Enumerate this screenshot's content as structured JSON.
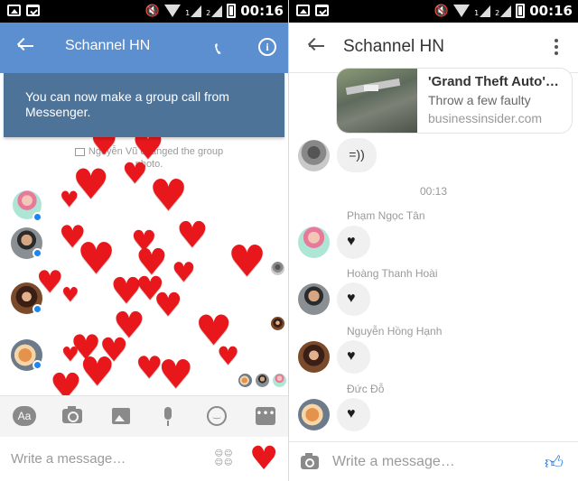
{
  "left_screen": {
    "status_bar": {
      "time": "00:16",
      "sim_labels": [
        "1",
        "2"
      ]
    },
    "header": {
      "title": "Schannel HN",
      "accent_color": "#5b8fcf"
    },
    "banner": {
      "text": "You can now make a group call from Messenger."
    },
    "system_note": "Nguyễn Vũ changed the group photo.",
    "icons": [
      "back-arrow-icon",
      "phone-icon",
      "info-icon",
      "heart-icon",
      "messenger-badge-icon"
    ],
    "toolbar": {
      "text_button_label": "Aa",
      "more_label": "•••"
    },
    "composer": {
      "placeholder": "Write a message…",
      "sticker_glyphs": "☺☺ ☺☺"
    },
    "hearts_color": "#e8171c"
  },
  "right_screen": {
    "status_bar": {
      "time": "00:16",
      "sim_labels": [
        "1",
        "2"
      ]
    },
    "header": {
      "title": "Schannel HN"
    },
    "link_preview": {
      "title": "'Grand Theft Auto'…",
      "subtitle": "Throw a few faulty",
      "domain": "businessinsider.com"
    },
    "emoticon_message": "=))",
    "time_separator": "00:13",
    "messages": [
      {
        "sender": "Phạm Ngọc Tân",
        "content": "♥"
      },
      {
        "sender": "Hoàng Thanh Hoài",
        "content": "♥"
      },
      {
        "sender": "Nguyễn Hồng Hạnh",
        "content": "♥"
      },
      {
        "sender": "Đức Đỗ",
        "content": "♥"
      }
    ],
    "composer": {
      "placeholder": "Write a message…"
    },
    "like_color": "#1d76e0"
  }
}
